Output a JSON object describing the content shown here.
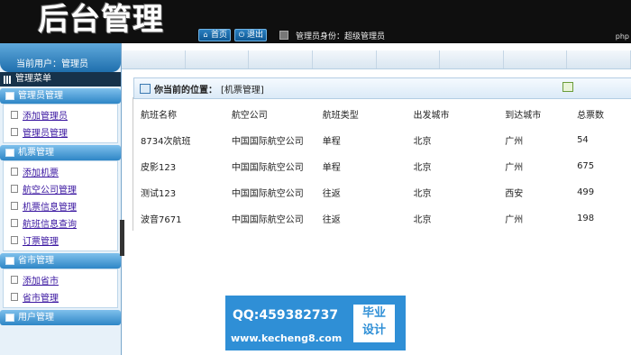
{
  "header": {
    "logo": "后台管理",
    "nav": [
      {
        "label": "首页",
        "icon": "home-icon"
      },
      {
        "label": "退出",
        "icon": "power-icon"
      }
    ],
    "admin_label": "管理员身份：超级管理员",
    "php_text": "php"
  },
  "sidebar": {
    "current_user": "当前用户：管理员",
    "menu_title": "管理菜单",
    "sections": [
      {
        "title": "管理员管理",
        "items": [
          "添加管理员",
          "管理员管理"
        ]
      },
      {
        "title": "机票管理",
        "items": [
          "添加机票",
          "航空公司管理",
          "机票信息管理",
          "航班信息查询",
          "订票管理"
        ]
      },
      {
        "title": "省市管理",
        "items": [
          "添加省市",
          "省市管理"
        ]
      },
      {
        "title": "用户管理",
        "items": []
      }
    ]
  },
  "main": {
    "location_label": "你当前的位置：",
    "location_value": "[机票管理]",
    "columns": [
      "航班名称",
      "航空公司",
      "航班类型",
      "出发城市",
      "到达城市",
      "总票数"
    ],
    "rows": [
      [
        "8734次航班",
        "中国国际航空公司",
        "单程",
        "北京",
        "广州",
        "54"
      ],
      [
        "皮影123",
        "中国国际航空公司",
        "单程",
        "北京",
        "广州",
        "675"
      ],
      [
        "测试123",
        "中国国际航空公司",
        "往返",
        "北京",
        "西安",
        "499"
      ],
      [
        "波音7671",
        "中国国际航空公司",
        "往返",
        "北京",
        "广州",
        "198"
      ]
    ]
  },
  "watermark": {
    "qq": "QQ:459382737",
    "url": "www.kecheng8.com",
    "badge_line1": "毕业",
    "badge_line2": "设计"
  }
}
